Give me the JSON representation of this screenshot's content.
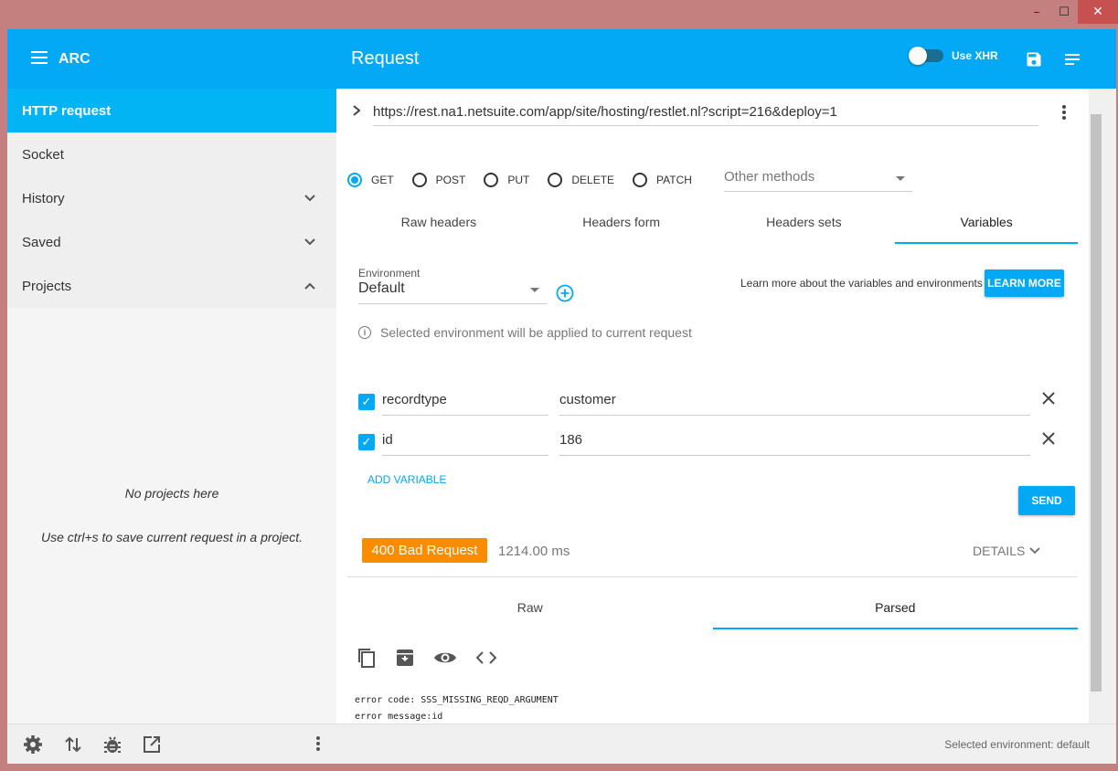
{
  "window": {
    "minimize": "–",
    "maximize": "☐",
    "close": "✕"
  },
  "topbar": {
    "app_name": "ARC",
    "title": "Request",
    "xhr_label": "Use XHR",
    "accent": "#03a9f4"
  },
  "sidebar": {
    "items": [
      {
        "label": "HTTP request",
        "active": true
      },
      {
        "label": "Socket"
      },
      {
        "label": "History",
        "chevron": "down"
      },
      {
        "label": "Saved",
        "chevron": "down"
      },
      {
        "label": "Projects",
        "chevron": "up"
      }
    ],
    "empty_title": "No projects here",
    "empty_hint": "Use ctrl+s to save current request in a project."
  },
  "request": {
    "url": "https://rest.na1.netsuite.com/app/site/hosting/restlet.nl?script=216&deploy=1",
    "methods": [
      "GET",
      "POST",
      "PUT",
      "DELETE",
      "PATCH"
    ],
    "selected_method": "GET",
    "other_methods_placeholder": "Other methods",
    "tabs": [
      "Raw headers",
      "Headers form",
      "Headers sets",
      "Variables"
    ],
    "active_tab": "Variables"
  },
  "variables": {
    "environment_label": "Environment",
    "environment_value": "Default",
    "learn_text": "Learn more about the variables and environments",
    "learn_button": "LEARN MORE",
    "info_text": "Selected environment will be applied to current request",
    "rows": [
      {
        "name": "recordtype",
        "value": "customer",
        "enabled": true
      },
      {
        "name": "id",
        "value": "186",
        "enabled": true
      }
    ],
    "add_variable": "ADD VARIABLE",
    "send": "SEND"
  },
  "response": {
    "status": "400 Bad Request",
    "status_color": "#fb8c00",
    "time": "1214.00 ms",
    "details": "DETAILS",
    "tabs": [
      "Raw",
      "Parsed"
    ],
    "active_tab": "Parsed",
    "tools": [
      "copy-icon",
      "archive-icon",
      "preview-icon",
      "code-icon"
    ],
    "body_lines": [
      "error code: SSS_MISSING_REQD_ARGUMENT",
      "error message:id"
    ]
  },
  "bottombar": {
    "icons": [
      "settings-icon",
      "import-export-icon",
      "bug-icon",
      "open-external-icon",
      "more-vert-icon"
    ],
    "env_status": "Selected environment: default"
  }
}
